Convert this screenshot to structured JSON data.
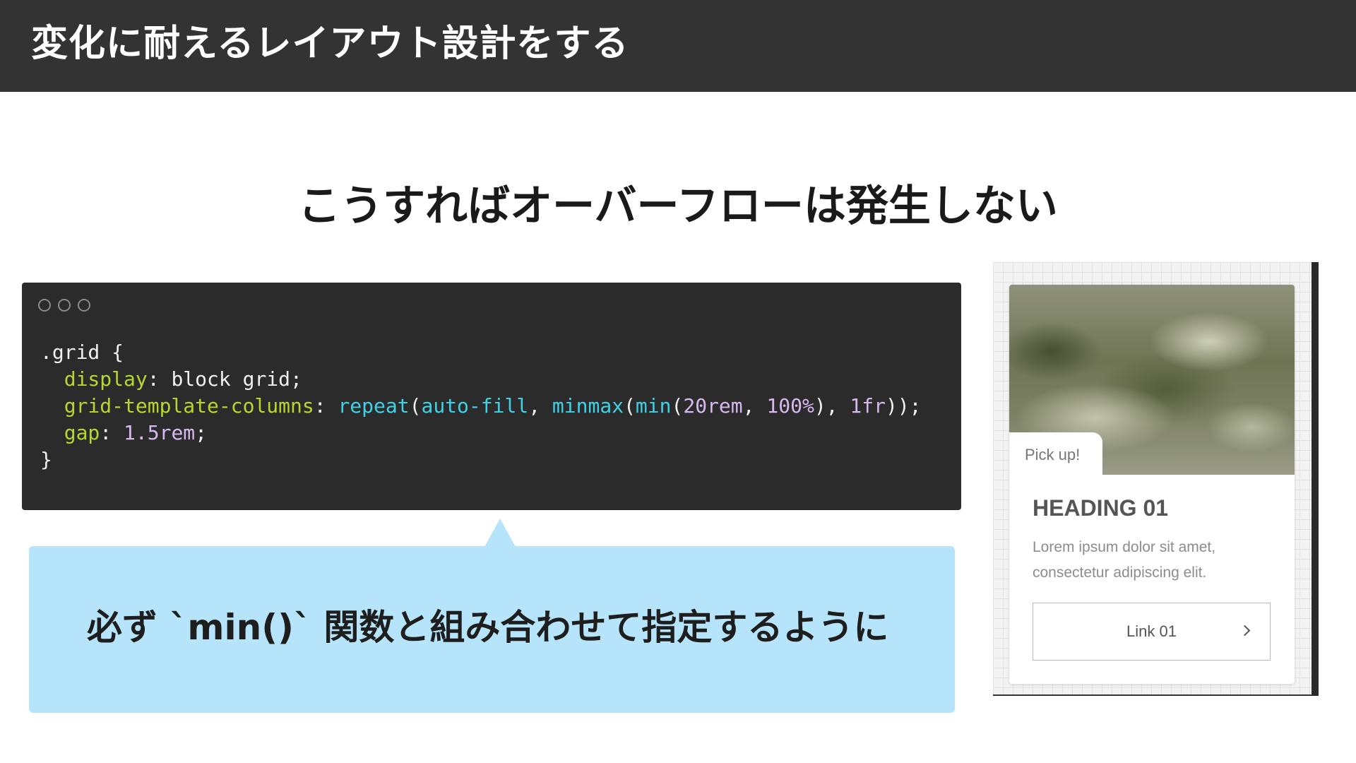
{
  "header": {
    "title": "変化に耐えるレイアウト設計をする"
  },
  "slide": {
    "subtitle": "こうすればオーバーフローは発生しない"
  },
  "code_window": {
    "lines": [
      [
        {
          "t": ".grid {",
          "c": "plain"
        }
      ],
      [
        {
          "t": "  ",
          "c": "plain"
        },
        {
          "t": "display",
          "c": "prop"
        },
        {
          "t": ": block grid;",
          "c": "plain"
        }
      ],
      [
        {
          "t": "  ",
          "c": "plain"
        },
        {
          "t": "grid-template-columns",
          "c": "prop"
        },
        {
          "t": ": ",
          "c": "plain"
        },
        {
          "t": "repeat",
          "c": "fn"
        },
        {
          "t": "(",
          "c": "plain"
        },
        {
          "t": "auto-fill",
          "c": "fn"
        },
        {
          "t": ", ",
          "c": "plain"
        },
        {
          "t": "minmax",
          "c": "fn"
        },
        {
          "t": "(",
          "c": "plain"
        },
        {
          "t": "min",
          "c": "fn"
        },
        {
          "t": "(",
          "c": "plain"
        },
        {
          "t": "20rem",
          "c": "num"
        },
        {
          "t": ", ",
          "c": "plain"
        },
        {
          "t": "100%",
          "c": "num"
        },
        {
          "t": "), ",
          "c": "plain"
        },
        {
          "t": "1fr",
          "c": "num"
        },
        {
          "t": "));",
          "c": "plain"
        }
      ],
      [
        {
          "t": "  ",
          "c": "plain"
        },
        {
          "t": "gap",
          "c": "prop"
        },
        {
          "t": ": ",
          "c": "plain"
        },
        {
          "t": "1.5rem",
          "c": "num"
        },
        {
          "t": ";",
          "c": "plain"
        }
      ],
      [
        {
          "t": "}",
          "c": "plain"
        }
      ]
    ]
  },
  "callout": {
    "text": "必ず `min()` 関数と組み合わせて指定するように"
  },
  "card": {
    "tag": "Pick up!",
    "heading": "HEADING 01",
    "body": "Lorem ipsum dolor sit amet, consectetur adipiscing elit.",
    "link_label": "Link 01",
    "link_icon": "chevron-right-icon"
  },
  "colors": {
    "header_bg": "#333333",
    "code_bg": "#2b2b2b",
    "code_property": "#b8d630",
    "code_function": "#3fd2e6",
    "code_number": "#d7b8f0",
    "callout_bg": "#b6e5fb"
  }
}
